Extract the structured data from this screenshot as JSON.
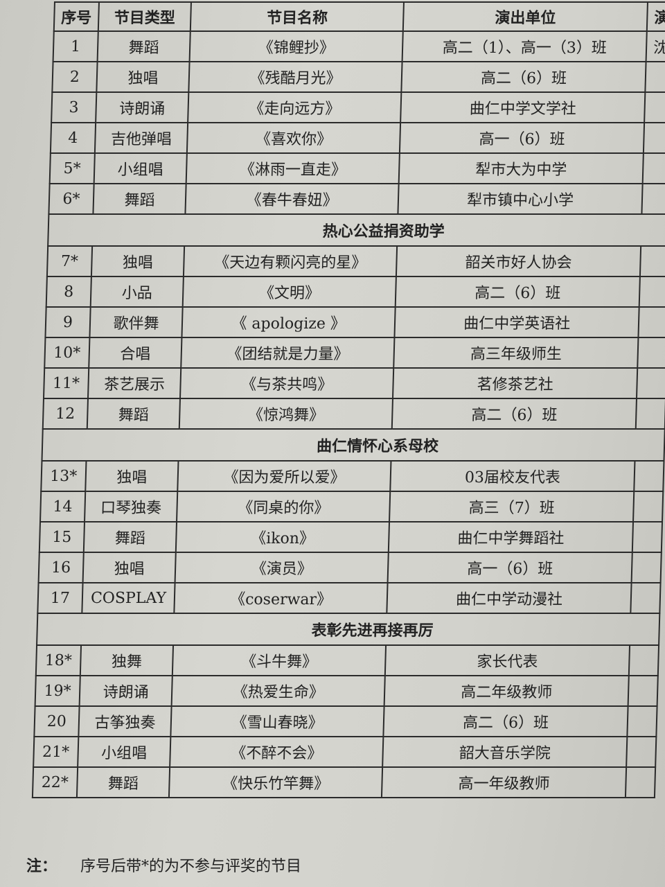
{
  "headers": {
    "no": "序号",
    "type": "节目类型",
    "name": "节目名称",
    "unit": "演出单位",
    "extra": "演"
  },
  "rows": [
    {
      "no": "1",
      "type": "舞蹈",
      "name": "《锦鲤抄》",
      "unit": "高二（1）、高一（3）班",
      "extra": "沈"
    },
    {
      "no": "2",
      "type": "独唱",
      "name": "《残酷月光》",
      "unit": "高二（6）班",
      "extra": ""
    },
    {
      "no": "3",
      "type": "诗朗诵",
      "name": "《走向远方》",
      "unit": "曲仁中学文学社",
      "extra": ""
    },
    {
      "no": "4",
      "type": "吉他弹唱",
      "name": "《喜欢你》",
      "unit": "高一（6）班",
      "extra": ""
    },
    {
      "no": "5*",
      "type": "小组唱",
      "name": "《淋雨一直走》",
      "unit": "犁市大为中学",
      "extra": ""
    },
    {
      "no": "6*",
      "type": "舞蹈",
      "name": "《春牛春妞》",
      "unit": "犁市镇中心小学",
      "extra": ""
    },
    {
      "section": "热心公益捐资助学"
    },
    {
      "no": "7*",
      "type": "独唱",
      "name": "《天边有颗闪亮的星》",
      "unit": "韶关市好人协会",
      "extra": ""
    },
    {
      "no": "8",
      "type": "小品",
      "name": "《文明》",
      "unit": "高二（6）班",
      "extra": ""
    },
    {
      "no": "9",
      "type": "歌伴舞",
      "name": "《 apologize 》",
      "unit": "曲仁中学英语社",
      "extra": ""
    },
    {
      "no": "10*",
      "type": "合唱",
      "name": "《团结就是力量》",
      "unit": "高三年级师生",
      "extra": ""
    },
    {
      "no": "11*",
      "type": "茶艺展示",
      "name": "《与茶共鸣》",
      "unit": "茗修茶艺社",
      "extra": ""
    },
    {
      "no": "12",
      "type": "舞蹈",
      "name": "《惊鸿舞》",
      "unit": "高二（6）班",
      "extra": ""
    },
    {
      "section": "曲仁情怀心系母校"
    },
    {
      "no": "13*",
      "type": "独唱",
      "name": "《因为爱所以爱》",
      "unit": "03届校友代表",
      "extra": ""
    },
    {
      "no": "14",
      "type": "口琴独奏",
      "name": "《同桌的你》",
      "unit": "高三（7）班",
      "extra": ""
    },
    {
      "no": "15",
      "type": "舞蹈",
      "name": "《ikon》",
      "unit": "曲仁中学舞蹈社",
      "extra": ""
    },
    {
      "no": "16",
      "type": "独唱",
      "name": "《演员》",
      "unit": "高一（6）班",
      "extra": ""
    },
    {
      "no": "17",
      "type": "COSPLAY",
      "name": "《coserwar》",
      "unit": "曲仁中学动漫社",
      "extra": ""
    },
    {
      "section": "表彰先进再接再厉"
    },
    {
      "no": "18*",
      "type": "独舞",
      "name": "《斗牛舞》",
      "unit": "家长代表",
      "extra": ""
    },
    {
      "no": "19*",
      "type": "诗朗诵",
      "name": "《热爱生命》",
      "unit": "高二年级教师",
      "extra": ""
    },
    {
      "no": "20",
      "type": "古筝独奏",
      "name": "《雪山春晓》",
      "unit": "高二（6）班",
      "extra": ""
    },
    {
      "no": "21*",
      "type": "小组唱",
      "name": "《不醉不会》",
      "unit": "韶大音乐学院",
      "extra": ""
    },
    {
      "no": "22*",
      "type": "舞蹈",
      "name": "《快乐竹竿舞》",
      "unit": "高一年级教师",
      "extra": ""
    }
  ],
  "note": {
    "label": "注：",
    "text": "序号后带*的为不参与评奖的节目"
  }
}
